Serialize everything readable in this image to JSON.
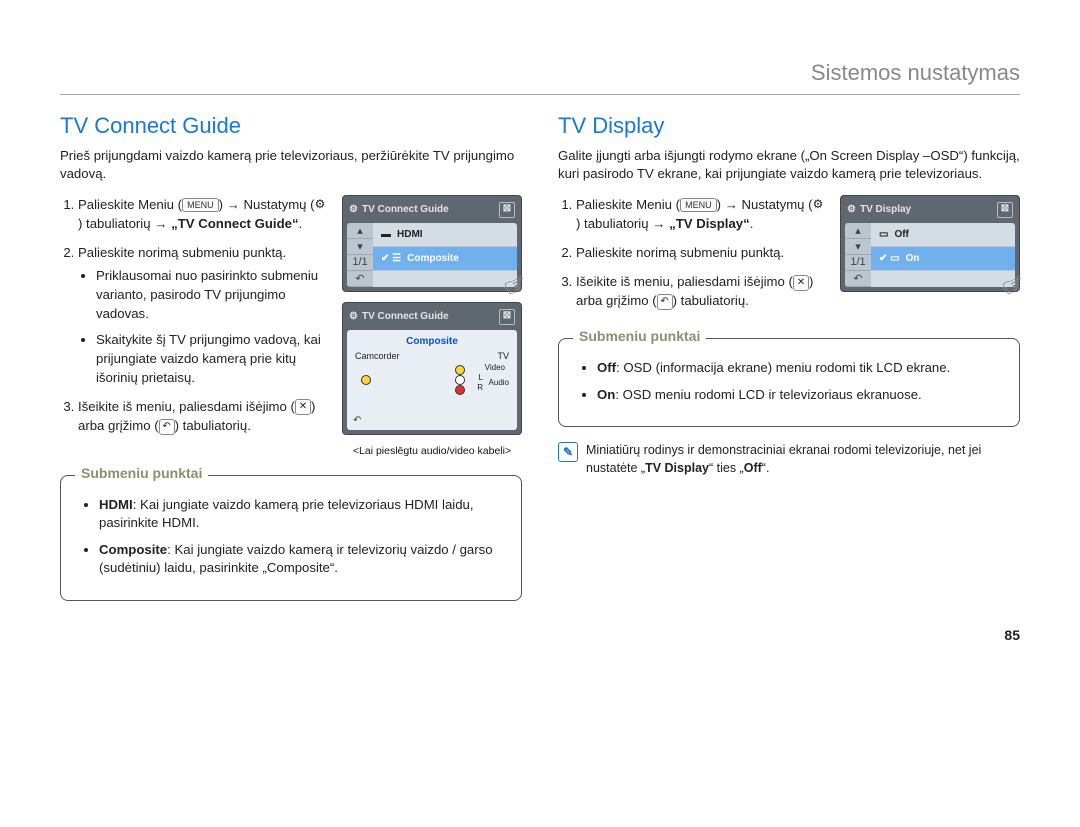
{
  "header": {
    "title": "Sistemos nustatymas"
  },
  "page_number": "85",
  "left": {
    "heading": "TV Connect Guide",
    "intro": "Prieš prijungdami vaizdo kamerą prie televizoriaus, peržiūrėkite TV prijungimo vadovą.",
    "step1_a": "Palieskite Meniu (",
    "step1_menu": "MENU",
    "step1_b": ") → Nustatymų (",
    "step1_c": ") tabuliatorių → ",
    "step1_bold": "„TV Connect Guide“",
    "step1_d": ".",
    "step2": "Palieskite norimą submeniu punktą.",
    "step2_sub1": "Priklausomai nuo pasirinkto submeniu varianto, pasirodo TV prijungimo vadovas.",
    "step2_sub2": "Skaitykite šį TV prijungimo vadovą, kai prijungiate vaizdo kamerą prie kitų išorinių prietaisų.",
    "step3_a": "Išeikite iš meniu, paliesdami išėjimo (",
    "step3_b": ") arba grįžimo (",
    "step3_c": ") tabuliatorių.",
    "shot1": {
      "title": "TV Connect Guide",
      "item1": "HDMI",
      "item2": "Composite",
      "page": "1/1",
      "back": "↶"
    },
    "shot2": {
      "title": "TV Connect Guide",
      "subtitle": "Composite",
      "left_label": "Camcorder",
      "right_label": "TV",
      "r1": "Video",
      "r2": "L",
      "r3": "R",
      "audio": "Audio",
      "caption": "<Lai pieslēgtu audio/video kabeli>"
    },
    "submenu": {
      "label": "Submeniu punktai",
      "item1_bold": "HDMI",
      "item1_text": ": Kai jungiate vaizdo kamerą prie televizoriaus HDMI laidu, pasirinkite HDMI.",
      "item2_bold": "Composite",
      "item2_text": ": Kai jungiate vaizdo kamerą ir televizorių vaizdo / garso (sudėtiniu) laidu, pasirinkite „Composite“."
    }
  },
  "right": {
    "heading": "TV Display",
    "intro": "Galite įjungti arba išjungti rodymo ekrane („On Screen Display –OSD“) funkciją, kuri pasirodo TV ekrane, kai prijungiate vaizdo kamerą prie televizoriaus.",
    "step1_a": "Palieskite Meniu (",
    "step1_menu": "MENU",
    "step1_b": ") → Nustatymų (",
    "step1_c": ") tabuliatorių → ",
    "step1_bold": "„TV Display“",
    "step1_d": ".",
    "step2": "Palieskite norimą submeniu punktą.",
    "step3_a": "Išeikite iš meniu, paliesdami išėjimo (",
    "step3_b": ") arba grįžimo (",
    "step3_c": ") tabuliatorių.",
    "shot": {
      "title": "TV Display",
      "item1": "Off",
      "item2": "On",
      "page": "1/1",
      "back": "↶"
    },
    "submenu": {
      "label": "Submeniu punktai",
      "item1_bold": "Off",
      "item1_text": ": OSD (informacija ekrane) meniu rodomi tik LCD ekrane.",
      "item2_bold": "On",
      "item2_text": ": OSD meniu rodomi LCD ir televizoriaus ekranuose."
    },
    "note": "Miniatiūrų rodinys ir demonstraciniai ekranai rodomi televizoriuje, net jei nustatėte „",
    "note_bold": "TV Display",
    "note_tail": "“ ties „",
    "note_off": "Off",
    "note_end": "“."
  }
}
